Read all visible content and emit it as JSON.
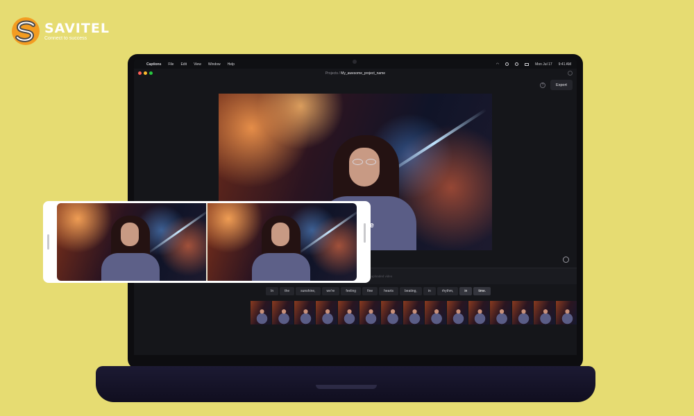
{
  "brand": {
    "name": "SAVITEL",
    "tagline": "Connect to success",
    "color_primary": "#f39c21",
    "color_secondary": "#4a4a4a"
  },
  "menubar": {
    "app_name": "Captions",
    "items": [
      "File",
      "Edit",
      "View",
      "Window",
      "Help"
    ],
    "date": "Mon Jul 17",
    "time": "9:41 AM"
  },
  "titlebar": {
    "breadcrumb_root": "Projects /",
    "project_name": "My_awesome_project_name"
  },
  "toolbar": {
    "help_icon": "question-icon",
    "export_label": "Export"
  },
  "preview": {
    "caption_line1": "we're",
    "caption_line2": "e"
  },
  "timeline": {
    "placeholder": "...uploaded video",
    "words": [
      "In",
      "the",
      "sunshine,",
      "we're",
      "feeling",
      "fine",
      "hearts",
      "beating,",
      "in",
      "rhythm,",
      "in",
      "time."
    ],
    "active_words": [
      10,
      11
    ]
  }
}
